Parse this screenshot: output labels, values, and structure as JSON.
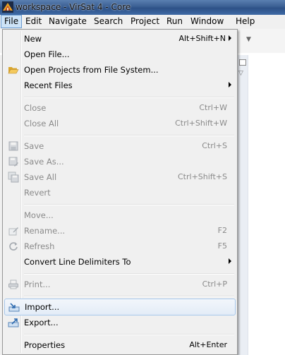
{
  "window": {
    "title": "workspace - VirSat 4 - Core"
  },
  "menubar": {
    "items": [
      "File",
      "Edit",
      "Navigate",
      "Search",
      "Project",
      "Run",
      "Window",
      "Help"
    ]
  },
  "file_menu": {
    "items": [
      {
        "label": "New",
        "accelerator": "Alt+Shift+N",
        "submenu": true,
        "enabled": true
      },
      {
        "label": "Open File...",
        "accelerator": "",
        "enabled": true
      },
      {
        "label": "Open Projects from File System...",
        "accelerator": "",
        "enabled": true,
        "icon": "folder-open-icon"
      },
      {
        "label": "Recent Files",
        "accelerator": "",
        "submenu": true,
        "enabled": true
      },
      {
        "label": "Close",
        "accelerator": "Ctrl+W",
        "enabled": false
      },
      {
        "label": "Close All",
        "accelerator": "Ctrl+Shift+W",
        "enabled": false
      },
      {
        "label": "Save",
        "accelerator": "Ctrl+S",
        "enabled": false,
        "icon": "save-icon"
      },
      {
        "label": "Save As...",
        "accelerator": "",
        "enabled": false,
        "icon": "save-as-icon"
      },
      {
        "label": "Save All",
        "accelerator": "Ctrl+Shift+S",
        "enabled": false,
        "icon": "save-all-icon"
      },
      {
        "label": "Revert",
        "accelerator": "",
        "enabled": false
      },
      {
        "label": "Move...",
        "accelerator": "",
        "enabled": false
      },
      {
        "label": "Rename...",
        "accelerator": "F2",
        "enabled": false,
        "icon": "rename-icon"
      },
      {
        "label": "Refresh",
        "accelerator": "F5",
        "enabled": false,
        "icon": "refresh-icon"
      },
      {
        "label": "Convert Line Delimiters To",
        "accelerator": "",
        "submenu": true,
        "enabled": true
      },
      {
        "label": "Print...",
        "accelerator": "Ctrl+P",
        "enabled": false,
        "icon": "print-icon"
      },
      {
        "label": "Import...",
        "accelerator": "",
        "enabled": true,
        "icon": "import-icon",
        "highlighted": true
      },
      {
        "label": "Export...",
        "accelerator": "",
        "enabled": true,
        "icon": "export-icon"
      },
      {
        "label": "Properties",
        "accelerator": "Alt+Enter",
        "enabled": true
      }
    ]
  },
  "colors": {
    "highlight_border": "#a8c8eb",
    "menu_background": "#f0f0f0",
    "disabled_text": "#8a8a8a"
  }
}
